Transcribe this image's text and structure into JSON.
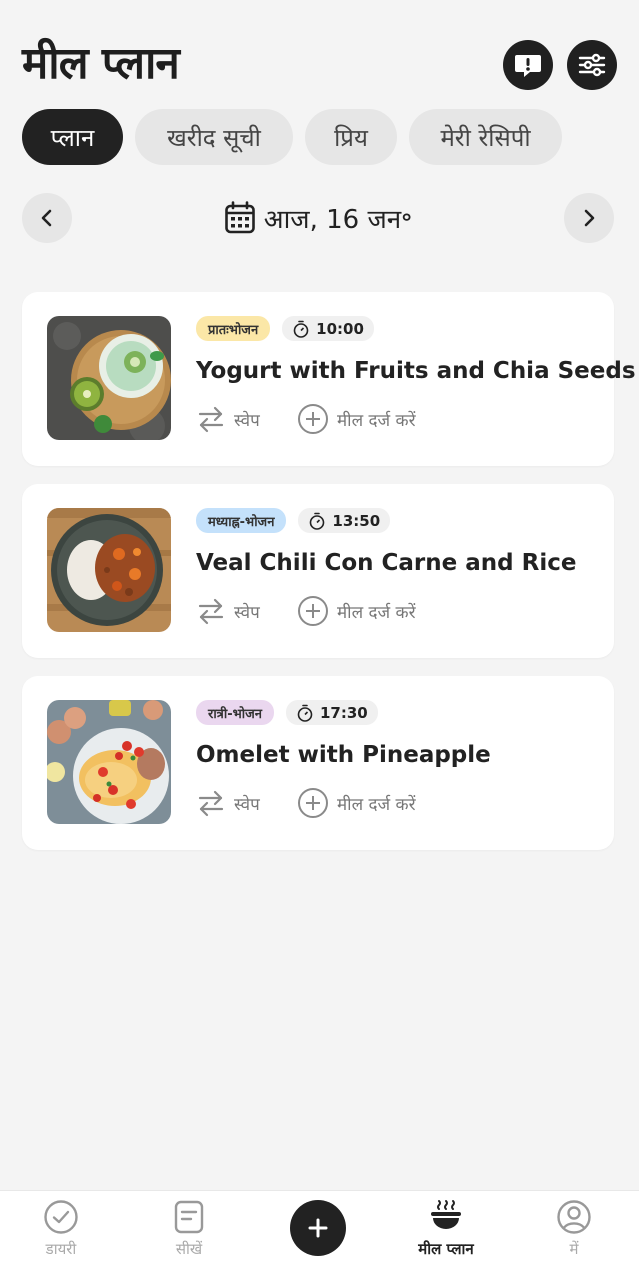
{
  "header": {
    "title": "मील प्लान"
  },
  "tabs": [
    {
      "label": "प्लान",
      "active": true
    },
    {
      "label": "खरीद सूची",
      "active": false
    },
    {
      "label": "प्रिय",
      "active": false
    },
    {
      "label": "मेरी रेसिपी",
      "active": false
    }
  ],
  "date": {
    "label": "आज, 16 जन॰"
  },
  "actions": {
    "swap": "स्वेप",
    "log": "मील दर्ज करें"
  },
  "meals": [
    {
      "type": "प्रातःभोजन",
      "type_color": "#fbe7a7",
      "time": "10:00",
      "title": "Yogurt with Fruits and Chia Seeds",
      "image": "yogurt-bowl-image"
    },
    {
      "type": "मध्याह्न-भोजन",
      "type_color": "#c4e1fb",
      "time": "13:50",
      "title": "Veal Chili Con Carne and Rice",
      "image": "chili-rice-image"
    },
    {
      "type": "रात्री-भोजन",
      "type_color": "#ead7ef",
      "time": "17:30",
      "title": "Omelet with Pineapple",
      "image": "omelet-image"
    }
  ],
  "bottom_nav": [
    {
      "label": "डायरी",
      "icon": "check-circle-icon"
    },
    {
      "label": "सीखें",
      "icon": "document-icon"
    },
    {
      "label": "मील प्लान",
      "icon": "food-bowl-icon",
      "active": true
    },
    {
      "label": "में",
      "icon": "profile-icon"
    }
  ],
  "colors": {
    "dark": "#222222",
    "background": "#f4f4f4",
    "chip_gray": "#e6e6e6"
  }
}
